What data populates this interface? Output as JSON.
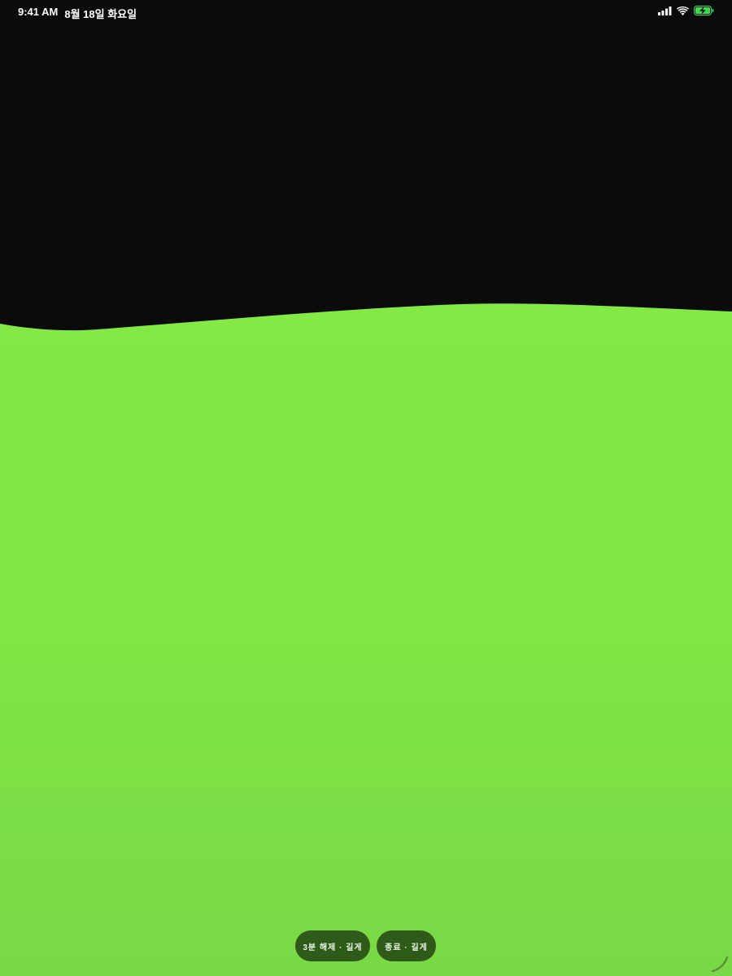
{
  "status_bar": {
    "time": "9:41 AM",
    "date": "8월 18일 화요일"
  },
  "colors": {
    "background_top": "#0b0b0c",
    "fill_green": "#7fe645",
    "fill_green_bottom": "#79d845",
    "pill_background": "#2f5a1a",
    "pill_text": "#e9f6df",
    "battery_charge": "#3ddb54"
  },
  "icons": {
    "cellular": "cellular-signal-icon",
    "wifi": "wifi-icon",
    "battery": "battery-charging-icon",
    "corner": "resize-corner-icon"
  },
  "controls": {
    "pause_label": "3분 해제 · 길게",
    "end_label": "종료 · 길게"
  }
}
